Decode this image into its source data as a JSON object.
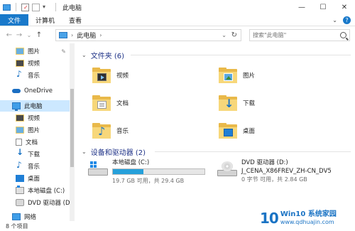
{
  "window": {
    "title": "此电脑",
    "controls": {
      "minimize": "—",
      "maximize": "☐",
      "close": "✕"
    }
  },
  "ribbon": {
    "tabs": [
      {
        "label": "文件",
        "active": true
      },
      {
        "label": "计算机",
        "active": false
      },
      {
        "label": "查看",
        "active": false
      }
    ],
    "expand": "⌄",
    "help": "?"
  },
  "address": {
    "back": "←",
    "forward": "→",
    "recent": "⌄",
    "up": "↑",
    "location": "此电脑",
    "separator": "›",
    "dropdown": "⌄",
    "refresh": "↻",
    "search_placeholder": "搜索\"此电脑\""
  },
  "sidebar": {
    "items": [
      {
        "label": "图片",
        "icon": "pictures-icon",
        "pinned": true
      },
      {
        "label": "视频",
        "icon": "video-icon"
      },
      {
        "label": "音乐",
        "icon": "music-icon"
      },
      {
        "label": "OneDrive",
        "icon": "onedrive-icon"
      },
      {
        "label": "此电脑",
        "icon": "this-pc-icon",
        "selected": true
      },
      {
        "label": "视频",
        "icon": "video-icon"
      },
      {
        "label": "图片",
        "icon": "pictures-icon"
      },
      {
        "label": "文档",
        "icon": "document-icon"
      },
      {
        "label": "下载",
        "icon": "download-icon"
      },
      {
        "label": "音乐",
        "icon": "music-icon"
      },
      {
        "label": "桌面",
        "icon": "desktop-icon"
      },
      {
        "label": "本地磁盘 (C:)",
        "icon": "drive-icon"
      },
      {
        "label": "DVD 驱动器 (D:)",
        "icon": "dvd-icon"
      },
      {
        "label": "网络",
        "icon": "network-icon"
      }
    ],
    "pin_glyph": "✎"
  },
  "folders_section": {
    "title": "文件夹 (6)",
    "chevron": "⌄",
    "items": [
      {
        "label": "视频",
        "icon": "video-folder-icon"
      },
      {
        "label": "图片",
        "icon": "pictures-folder-icon"
      },
      {
        "label": "文档",
        "icon": "documents-folder-icon"
      },
      {
        "label": "下载",
        "icon": "downloads-folder-icon"
      },
      {
        "label": "音乐",
        "icon": "music-folder-icon"
      },
      {
        "label": "桌面",
        "icon": "desktop-folder-icon"
      }
    ]
  },
  "drives_section": {
    "title": "设备和驱动器 (2)",
    "chevron": "⌄",
    "drives": [
      {
        "name": "本地磁盘 (C:)",
        "space": "19.7 GB 可用，共 29.4 GB",
        "used_fraction": 0.33,
        "icon": "local-disk-icon"
      },
      {
        "name": "DVD 驱动器 (D:)",
        "label": "J_CENA_X86FREV_ZH-CN_DV5",
        "space": "0 字节 可用，共 2.84 GB",
        "icon": "dvd-drive-icon"
      }
    ]
  },
  "status": {
    "items_count": "8 个项目"
  },
  "watermark": {
    "number": "10",
    "title": "Win10 系统家园",
    "url": "www.qdhuajin.com"
  }
}
